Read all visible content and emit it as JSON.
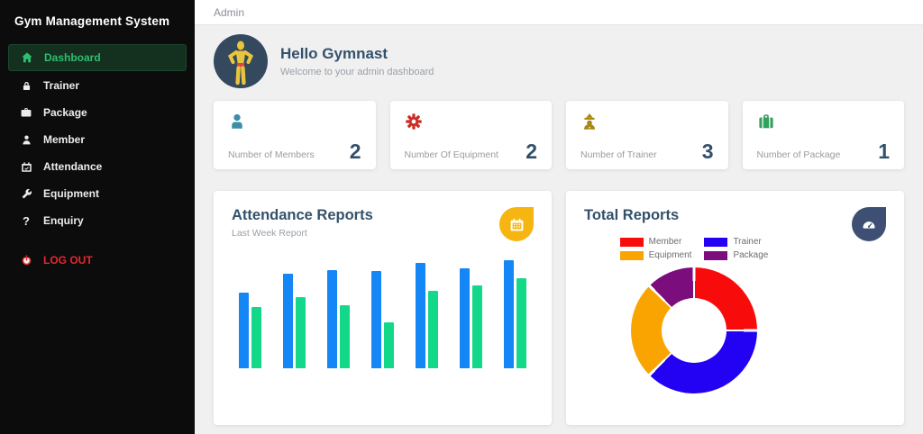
{
  "app": {
    "title": "Gym Management System"
  },
  "topbar": {
    "breadcrumb": "Admin"
  },
  "sidebar": {
    "items": [
      {
        "label": "Dashboard",
        "icon": "home-icon",
        "active": true
      },
      {
        "label": "Trainer",
        "icon": "lock-icon",
        "active": false
      },
      {
        "label": "Package",
        "icon": "briefcase-icon",
        "active": false
      },
      {
        "label": "Member",
        "icon": "user-icon",
        "active": false
      },
      {
        "label": "Attendance",
        "icon": "calendar-check-icon",
        "active": false
      },
      {
        "label": "Equipment",
        "icon": "wrench-icon",
        "active": false
      },
      {
        "label": "Enquiry",
        "icon": "question-icon",
        "active": false
      }
    ],
    "logout_label": "LOG OUT"
  },
  "welcome": {
    "title": "Hello Gymnast",
    "subtitle": "Welcome to your admin dashboard"
  },
  "stats": [
    {
      "label": "Number of Members",
      "value": "2",
      "icon": "member-icon",
      "icon_color": "#3d8da8"
    },
    {
      "label": "Number Of Equipment",
      "value": "2",
      "icon": "gear-icon",
      "icon_color": "#cc2b24"
    },
    {
      "label": "Number of Trainer",
      "value": "3",
      "icon": "trainer-icon",
      "icon_color": "#a8880f"
    },
    {
      "label": "Number of Package",
      "value": "1",
      "icon": "suitcase-icon",
      "icon_color": "#34a05f"
    }
  ],
  "cards": {
    "attendance": {
      "title": "Attendance Reports",
      "subtitle": "Last Week Report",
      "icon": "calendar-icon",
      "icon_bg": "#f6b511"
    },
    "total": {
      "title": "Total Reports",
      "icon": "gauge-icon",
      "icon_bg": "#3d5074"
    }
  },
  "colors": {
    "sidebar_bg": "#0c0c0c",
    "active_green": "#2ebe70",
    "logout_red": "#e5282f",
    "heading_navy": "#33516b",
    "bar_blue": "#1586f5",
    "bar_green": "#14d889",
    "avatar_bg": "#34495e"
  },
  "chart_data": [
    {
      "type": "bar",
      "title": "Attendance Reports",
      "subtitle": "Last Week Report",
      "categories": [
        "1",
        "2",
        "3",
        "4",
        "5",
        "6",
        "7"
      ],
      "series": [
        {
          "name": "series-blue",
          "color": "#1586f5",
          "values": [
            84,
            105,
            109,
            108,
            117,
            111,
            120
          ]
        },
        {
          "name": "series-green",
          "color": "#14d889",
          "values": [
            68,
            79,
            70,
            51,
            86,
            92,
            100
          ]
        }
      ],
      "ylim": [
        0,
        130
      ],
      "axis_labels_visible": false,
      "grid": false,
      "units": "relative (no axis shown)"
    },
    {
      "type": "pie",
      "donut": true,
      "title": "Total Reports",
      "legend_position": "top",
      "direction": "clockwise",
      "start_angle_deg": 0,
      "slices": [
        {
          "label": "Member",
          "value": 2,
          "color": "#f70b0b"
        },
        {
          "label": "Trainer",
          "value": 3,
          "color": "#2301f3"
        },
        {
          "label": "Equipment",
          "value": 2,
          "color": "#f9a400"
        },
        {
          "label": "Package",
          "value": 1,
          "color": "#7c0d7c"
        }
      ]
    }
  ]
}
